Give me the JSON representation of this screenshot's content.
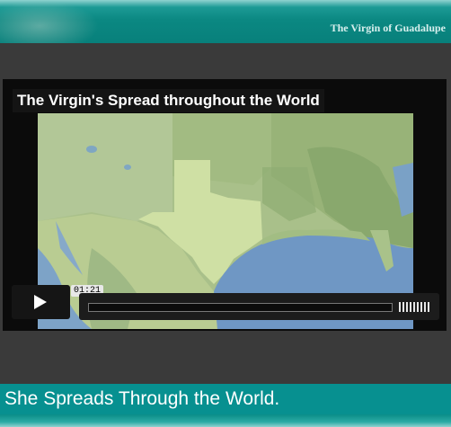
{
  "header": {
    "title": "The Virgin of Guadalupe"
  },
  "player": {
    "video_title": "The Virgin's Spread throughout the World",
    "current_time": "01:21",
    "progress_fraction": 0.0,
    "volume_bars": 10,
    "play_icon": "play-icon"
  },
  "caption": {
    "text": "She Spreads Through the World."
  },
  "colors": {
    "teal": "#079090",
    "player_bg": "#0b0b0b",
    "page_bg": "#3a3a3a"
  }
}
